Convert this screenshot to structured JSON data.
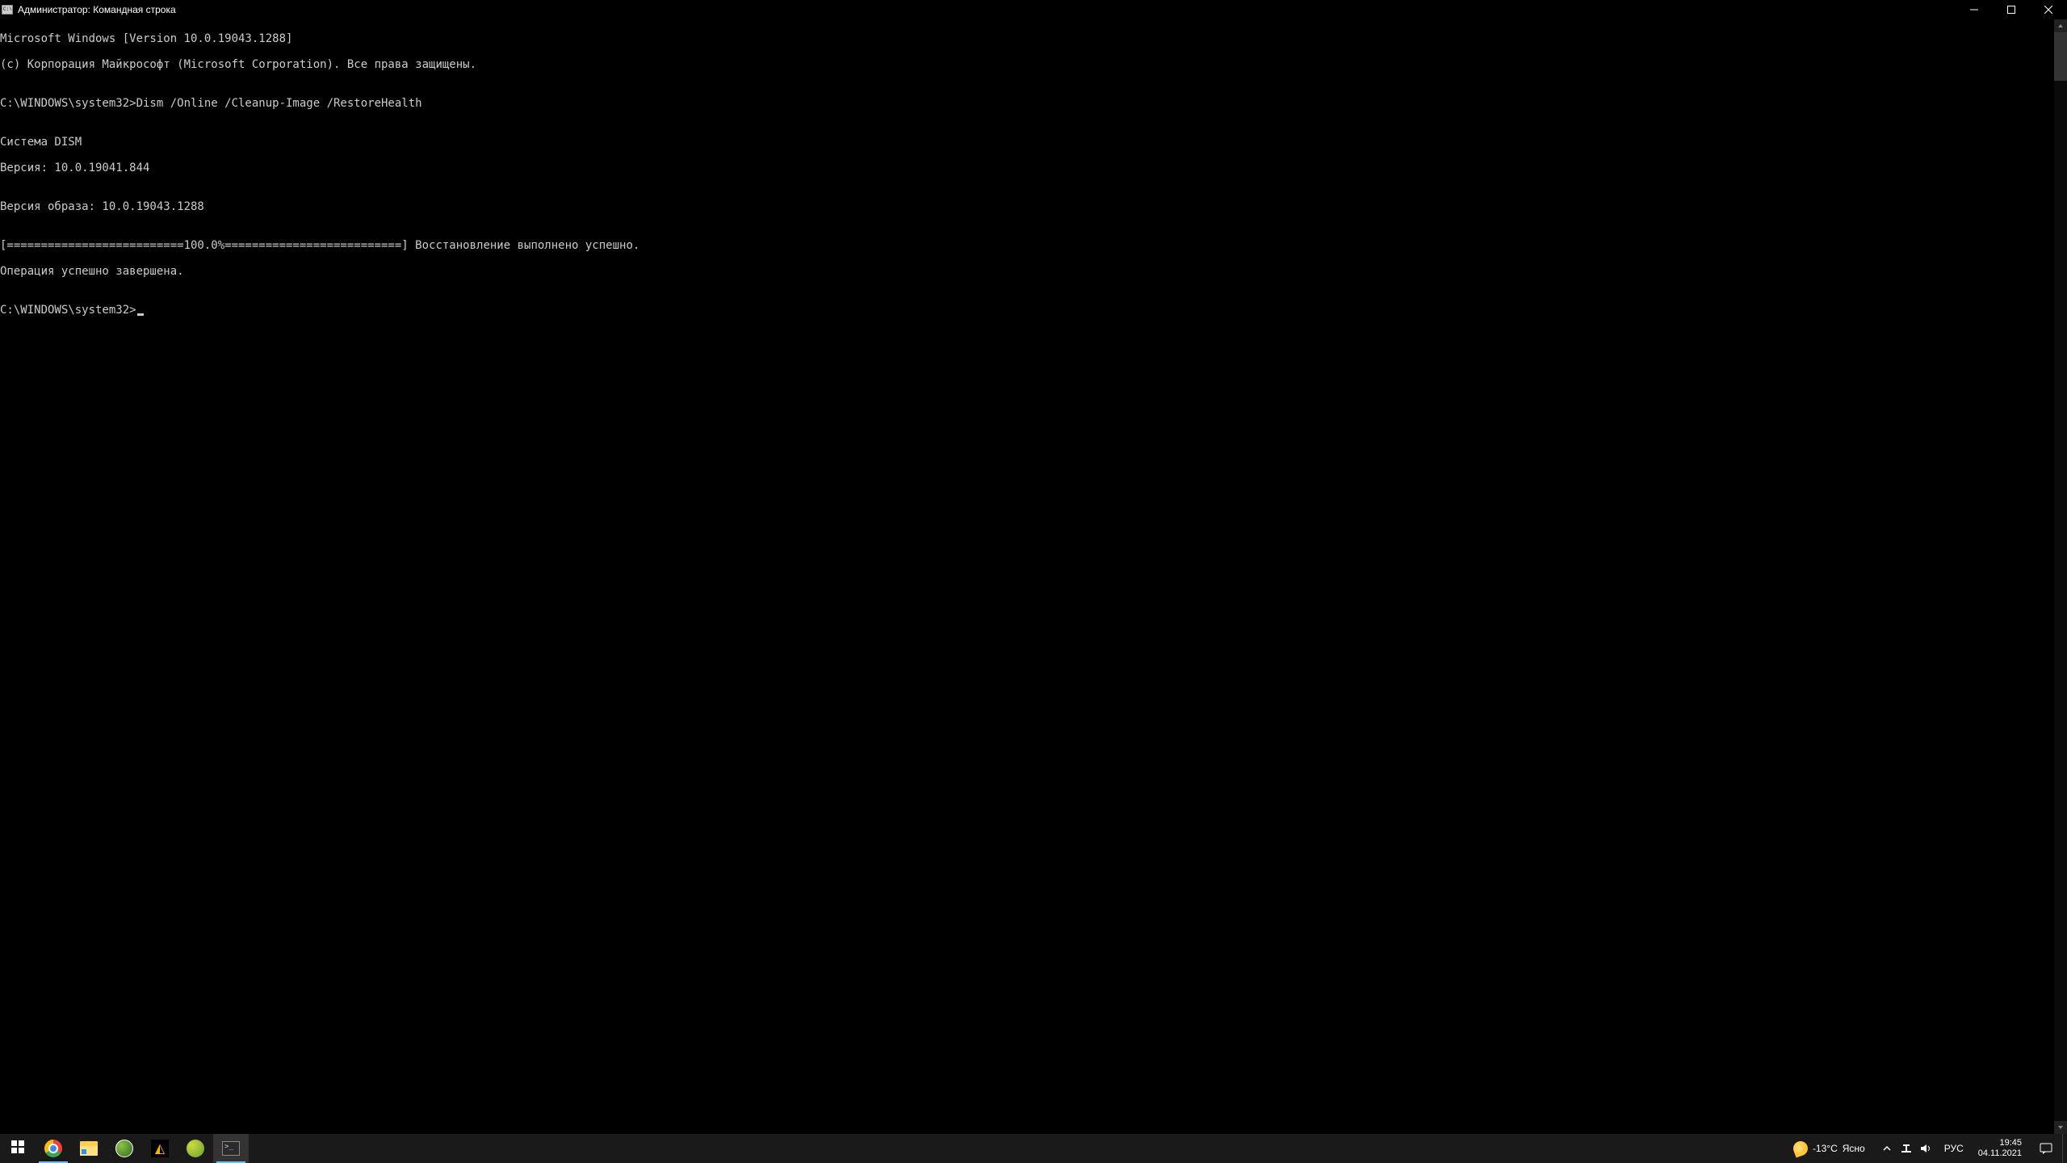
{
  "window": {
    "title": "Администратор: Командная строка"
  },
  "terminal": {
    "lines": [
      "Microsoft Windows [Version 10.0.19043.1288]",
      "(c) Корпорация Майкрософт (Microsoft Corporation). Все права защищены.",
      "",
      "C:\\WINDOWS\\system32>Dism /Online /Cleanup-Image /RestoreHealth",
      "",
      "Cистема DISM",
      "Версия: 10.0.19041.844",
      "",
      "Версия образа: 10.0.19043.1288",
      "",
      "[==========================100.0%==========================] Восстановление выполнено успешно.",
      "Операция успешно завершена.",
      ""
    ],
    "prompt": "C:\\WINDOWS\\system32>"
  },
  "taskbar": {
    "weather": {
      "temp": "-13°C",
      "desc": "Ясно"
    },
    "lang": "РУС",
    "clock": {
      "time": "19:45",
      "date": "04.11.2021"
    }
  }
}
